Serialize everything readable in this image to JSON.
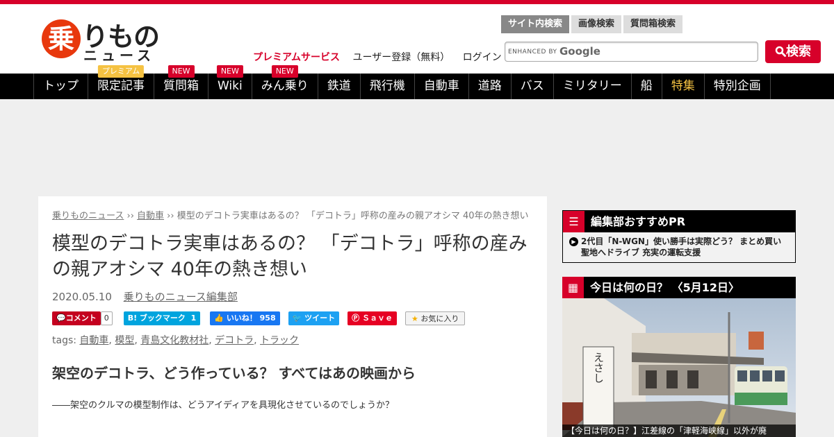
{
  "brand": {
    "logo_kanji": "乗",
    "logo_kana": "りもの",
    "logo_sub": "ニュース"
  },
  "header_links": {
    "premium": "プレミアムサービス",
    "register": "ユーザー登録（無料）",
    "login": "ログイン"
  },
  "search": {
    "tabs": [
      "サイト内検索",
      "画像検索",
      "質問箱検索"
    ],
    "enhanced": "ENHANCED BY",
    "google": "Google",
    "button": "検索"
  },
  "nav": [
    {
      "label": "トップ",
      "badge": ""
    },
    {
      "label": "限定記事",
      "badge": "プレミアム"
    },
    {
      "label": "質問箱",
      "badge": "NEW"
    },
    {
      "label": "Wiki",
      "badge": "NEW"
    },
    {
      "label": "みん乗り",
      "badge": "NEW"
    },
    {
      "label": "鉄道",
      "badge": ""
    },
    {
      "label": "飛行機",
      "badge": ""
    },
    {
      "label": "自動車",
      "badge": ""
    },
    {
      "label": "道路",
      "badge": ""
    },
    {
      "label": "バス",
      "badge": ""
    },
    {
      "label": "ミリタリー",
      "badge": ""
    },
    {
      "label": "船",
      "badge": ""
    },
    {
      "label": "特集",
      "badge": ""
    },
    {
      "label": "特別企画",
      "badge": ""
    }
  ],
  "article": {
    "breadcrumb": [
      "乗りものニュース",
      "自動車",
      "模型のデコトラ実車はあるの？ 「デコトラ」呼称の産みの親アオシマ 40年の熱き想い"
    ],
    "breadcrumb_sep": " ›› ",
    "title": "模型のデコトラ実車はあるの？ 「デコトラ」呼称の産みの親アオシマ 40年の熱き想い",
    "date": "2020.05.10",
    "author": "乗りものニュース編集部",
    "social": {
      "comment": "コメント",
      "comment_count": "0",
      "hatena": "B! ブックマーク",
      "hatena_count": "1",
      "like": "いいね！",
      "like_count": "958",
      "tweet": "ツイート",
      "pin": "Ｓａｖｅ",
      "fav": "お気に入り"
    },
    "tags_label": "tags:",
    "tags": [
      "自動車",
      "模型",
      "青島文化教材社",
      "デコトラ",
      "トラック"
    ],
    "heading": "架空のデコトラ、どう作っている？ すべてはあの映画から",
    "lead": "――架空のクルマの模型制作は、どうアイディアを具現化させているのでしょうか？"
  },
  "sidebar": {
    "pr": {
      "title": "編集部おすすめPR",
      "item": "2代目「N-WGN」使い勝手は実際どう？ まとめ買い聖地へドライブ 充実の運転支援"
    },
    "today": {
      "title": "今日は何の日？ 〈5月12日〉",
      "sign": "えさし",
      "caption": "【今日は何の日？】江差線の「津軽海峡線」以外が廃"
    }
  },
  "colors": {
    "accent": "#d7002a",
    "premium_badge": "#f5c242",
    "twitter": "#1da1f2",
    "facebook": "#1877f2",
    "pinterest": "#e60023",
    "hatena": "#00a4de"
  }
}
